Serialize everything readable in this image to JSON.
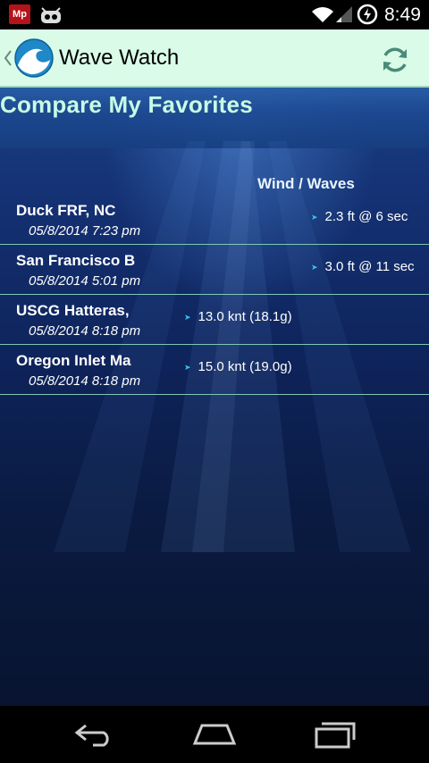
{
  "status_bar": {
    "notification_badge": "Mp",
    "time": "8:49"
  },
  "action_bar": {
    "title": "Wave Watch",
    "icons": [
      "up-caret-icon",
      "wave-logo-icon",
      "refresh-icon"
    ]
  },
  "page": {
    "title": "Compare My Favorites",
    "column_header": "Wind / Waves"
  },
  "favorites": [
    {
      "station": "Duck FRF, NC",
      "timestamp": "05/8/2014 7:23 pm",
      "reading": "2.3 ft @ 6 sec"
    },
    {
      "station": "San Francisco B",
      "timestamp": "05/8/2014 5:01 pm",
      "reading": "3.0 ft @ 11 sec"
    },
    {
      "station": "USCG Hatteras,",
      "timestamp": "05/8/2014 8:18 pm",
      "reading": "13.0 knt (18.1g)"
    },
    {
      "station": "Oregon Inlet Ma",
      "timestamp": "05/8/2014 8:18 pm",
      "reading": "15.0 knt (19.0g)"
    }
  ],
  "colors": {
    "action_bar_bg": "#d9fbe8",
    "title_accent": "#c8fbe4",
    "arrow": "#37c4ee",
    "divider": "#7fc7b8"
  },
  "nav_bar": {
    "icons": [
      "back-icon",
      "home-icon",
      "recents-icon"
    ]
  }
}
